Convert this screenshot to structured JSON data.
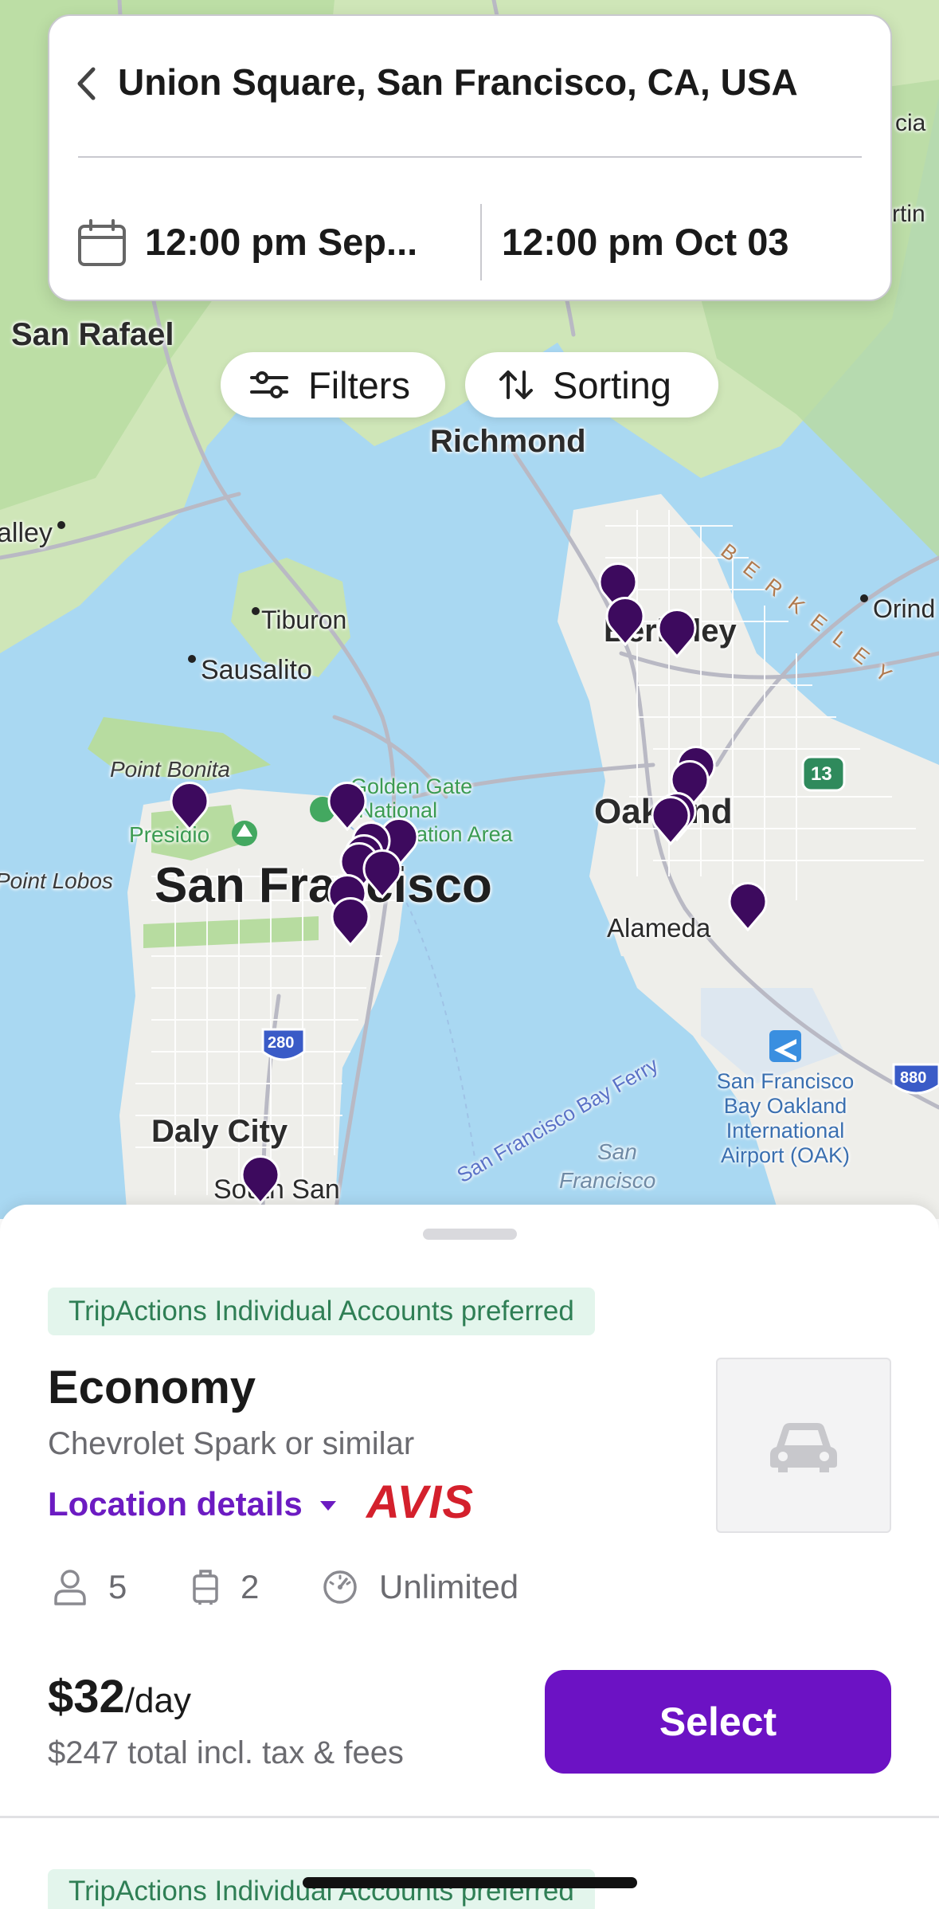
{
  "map": {
    "labels": {
      "san_rafael": "San Rafael",
      "richmond": "Richmond",
      "valley": "alley",
      "tiburon": "Tiburon",
      "sausalito": "Sausalito",
      "berkeley_city": "Berkeley",
      "orinda": "Orind",
      "berkeley_hills": "BERKELEY",
      "point_bonita": "Point Bonita",
      "golden_gate_1": "Golden Gate",
      "golden_gate_2": "National",
      "golden_gate_3": "Recreation Area",
      "presidio": "Presidio",
      "oakland": "Oakland",
      "point_lobos": "Point Lobos",
      "san_francisco": "San Francisco",
      "alameda": "Alameda",
      "daly_city": "Daly City",
      "south_sf": "South San",
      "ferry": "San Francisco Bay Ferry",
      "bay_1": "San",
      "bay_2": "Francisco",
      "airport": "San Francisco Bay Oakland International Airport (OAK)",
      "cia": "cia",
      "rtin": "rtin",
      "route_280": "280",
      "route_13": "13",
      "route_880": "880"
    },
    "marker_color": "#3d0a5e"
  },
  "search": {
    "location": "Union Square, San Francisco, CA, USA",
    "pickup": "12:00 pm Sep...",
    "dropoff": "12:00 pm Oct 03"
  },
  "controls": {
    "filters": "Filters",
    "sorting": "Sorting"
  },
  "listing": {
    "preferred_badge": "TripActions Individual Accounts preferred",
    "car_class": "Economy",
    "car_model": "Chevrolet Spark or similar",
    "location_details": "Location details",
    "vendor": "AVIS",
    "passengers": "5",
    "bags": "2",
    "mileage": "Unlimited",
    "price_daily": "$32",
    "price_unit": "/day",
    "price_total": "$247 total incl. tax & fees",
    "select": "Select"
  },
  "next_listing": {
    "preferred_badge": "TripActions Individual Accounts preferred"
  },
  "colors": {
    "accent": "#6c12c4",
    "vendor": "#d4202c",
    "badge_bg": "#e3f5ec",
    "badge_text": "#2f7f55"
  }
}
